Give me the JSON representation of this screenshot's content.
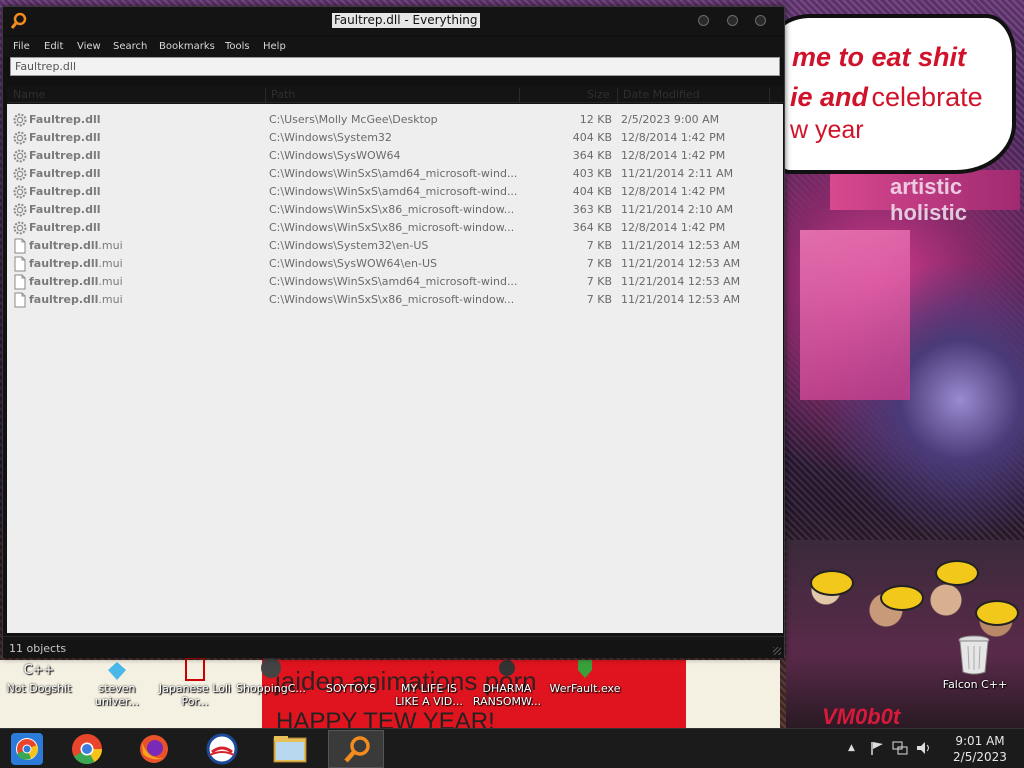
{
  "window": {
    "title": "Faultrep.dll - Everything",
    "menu": [
      "File",
      "Edit",
      "View",
      "Search",
      "Bookmarks",
      "Tools",
      "Help"
    ],
    "search_value": "Faultrep.dll",
    "columns": [
      "Name",
      "Path",
      "Size",
      "Date Modified"
    ],
    "rows": [
      {
        "icon": "gear-file-icon",
        "name": "Faultrep.dll",
        "ext": "",
        "path": "C:\\Users\\Molly McGee\\Desktop",
        "size": "12 KB",
        "date": "2/5/2023 9:00 AM"
      },
      {
        "icon": "gear-file-icon",
        "name": "Faultrep.dll",
        "ext": "",
        "path": "C:\\Windows\\System32",
        "size": "404 KB",
        "date": "12/8/2014 1:42 PM"
      },
      {
        "icon": "gear-file-icon",
        "name": "Faultrep.dll",
        "ext": "",
        "path": "C:\\Windows\\SysWOW64",
        "size": "364 KB",
        "date": "12/8/2014 1:42 PM"
      },
      {
        "icon": "gear-file-icon",
        "name": "Faultrep.dll",
        "ext": "",
        "path": "C:\\Windows\\WinSxS\\amd64_microsoft-wind...",
        "size": "403 KB",
        "date": "11/21/2014 2:11 AM"
      },
      {
        "icon": "gear-file-icon",
        "name": "Faultrep.dll",
        "ext": "",
        "path": "C:\\Windows\\WinSxS\\amd64_microsoft-wind...",
        "size": "404 KB",
        "date": "12/8/2014 1:42 PM"
      },
      {
        "icon": "gear-file-icon",
        "name": "Faultrep.dll",
        "ext": "",
        "path": "C:\\Windows\\WinSxS\\x86_microsoft-window...",
        "size": "363 KB",
        "date": "11/21/2014 2:10 AM"
      },
      {
        "icon": "gear-file-icon",
        "name": "Faultrep.dll",
        "ext": "",
        "path": "C:\\Windows\\WinSxS\\x86_microsoft-window...",
        "size": "364 KB",
        "date": "12/8/2014 1:42 PM"
      },
      {
        "icon": "blank-file-icon",
        "name": "faultrep.dll",
        "ext": ".mui",
        "path": "C:\\Windows\\System32\\en-US",
        "size": "7 KB",
        "date": "11/21/2014 12:53 AM"
      },
      {
        "icon": "blank-file-icon",
        "name": "faultrep.dll",
        "ext": ".mui",
        "path": "C:\\Windows\\SysWOW64\\en-US",
        "size": "7 KB",
        "date": "11/21/2014 12:53 AM"
      },
      {
        "icon": "blank-file-icon",
        "name": "faultrep.dll",
        "ext": ".mui",
        "path": "C:\\Windows\\WinSxS\\amd64_microsoft-wind...",
        "size": "7 KB",
        "date": "11/21/2014 12:53 AM"
      },
      {
        "icon": "blank-file-icon",
        "name": "faultrep.dll",
        "ext": ".mui",
        "path": "C:\\Windows\\WinSxS\\x86_microsoft-window...",
        "size": "7 KB",
        "date": "11/21/2014 12:53 AM"
      }
    ],
    "status": "11 objects"
  },
  "wallpaper": {
    "bubble_line1": "me to eat shit",
    "bubble_line2a": "ie and",
    "bubble_line2b": "celebrate",
    "bubble_line3": "w year",
    "sign_text": "artistic holistic",
    "banner_text": "jaiden animations porn",
    "banner_text2": "HAPPY TEW YEAR!",
    "tag_text": "VM0b0t"
  },
  "desktop_icons": [
    {
      "label": "Not Dogshit",
      "icon": "cpp-icon"
    },
    {
      "label": "steven univer...",
      "icon": "gem-icon"
    },
    {
      "label": "Japanese Loli Por...",
      "icon": "document-icon"
    },
    {
      "label": "ShoppingC...",
      "icon": "cart-icon"
    },
    {
      "label": "SOYTOYS",
      "icon": "app-icon"
    },
    {
      "label": "MY LIFE IS LIKE A VID...",
      "icon": "gamepad-icon"
    },
    {
      "label": "DHARMA RANSOMW...",
      "icon": "skull-icon"
    },
    {
      "label": "WerFault.exe",
      "icon": "shield-icon"
    },
    {
      "label": "Falcon C++",
      "icon": "recycle-bin-icon"
    }
  ],
  "taskbar": {
    "apps": [
      "chrome-os-icon",
      "chrome-icon",
      "firefox-icon",
      "obama-logo-icon",
      "file-manager-icon",
      "everything-search-icon"
    ],
    "time": "9:01 AM",
    "date": "2/5/2023"
  },
  "colors": {
    "accent": "#f28c1e",
    "title_highlight": "#e6e6e6",
    "list_bg": "#eeeeee"
  }
}
